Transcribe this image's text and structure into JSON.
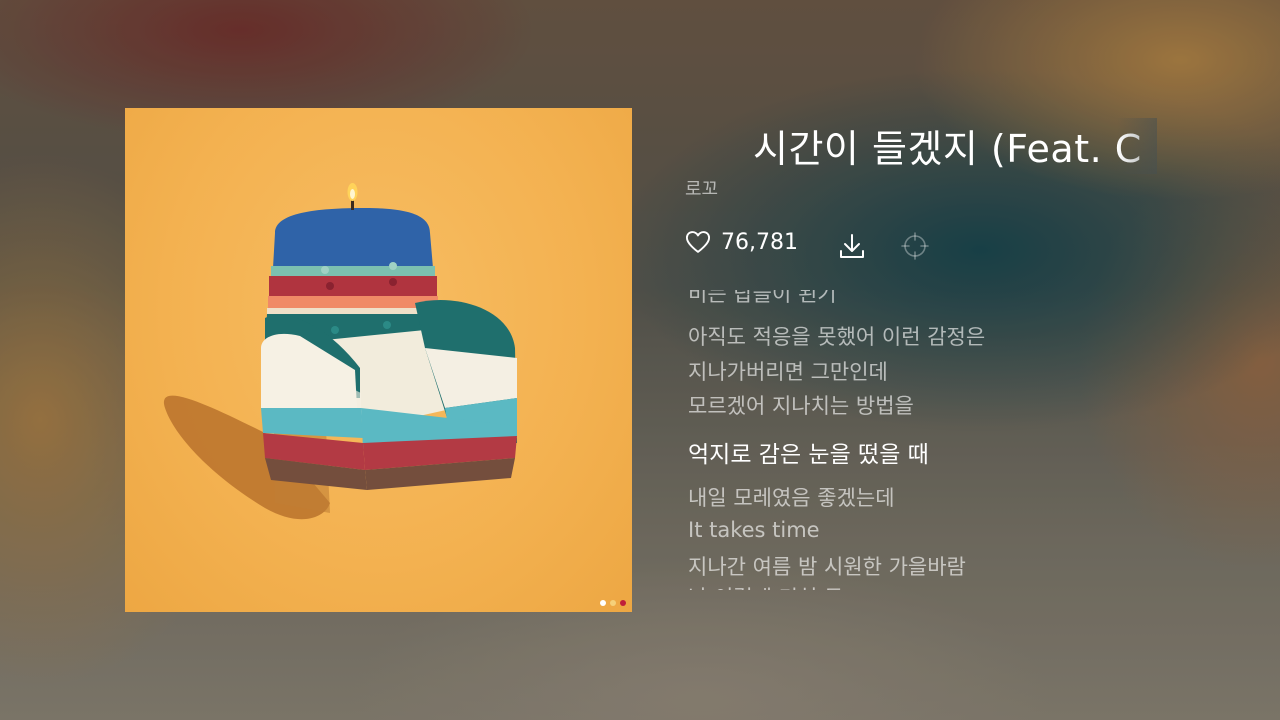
{
  "song": {
    "title": "시간이 들겠지 (Feat. C",
    "artist": "로꼬",
    "like_count": "76,781"
  },
  "icons": {
    "like": "heart-outline-icon",
    "download": "download-icon",
    "focus": "crosshair-icon"
  },
  "cover": {
    "page_dots": [
      "#ffffff",
      "#f5d07a",
      "#c0203a"
    ]
  },
  "lyrics": {
    "lines": [
      {
        "text": "비는 탑들이 된기",
        "current": false
      },
      {
        "text": "아직도 적응을 못했어 이런 감정은",
        "current": false
      },
      {
        "text": "지나가버리면 그만인데",
        "current": false
      },
      {
        "text": "모르겠어 지나치는 방법을",
        "current": false
      },
      {
        "text": "억지로 감은 눈을 떴을 때",
        "current": true
      },
      {
        "text": "내일 모레였음 좋겠는데",
        "current": false
      },
      {
        "text": "It takes time",
        "current": false
      },
      {
        "text": "지나간 여름 밤 시원한 가을바람",
        "current": false
      },
      {
        "text": "난 이렇게 미쳐 둔",
        "current": false
      }
    ]
  },
  "colors": {
    "cover_background": "#f3b150",
    "text_primary": "#ffffff"
  }
}
